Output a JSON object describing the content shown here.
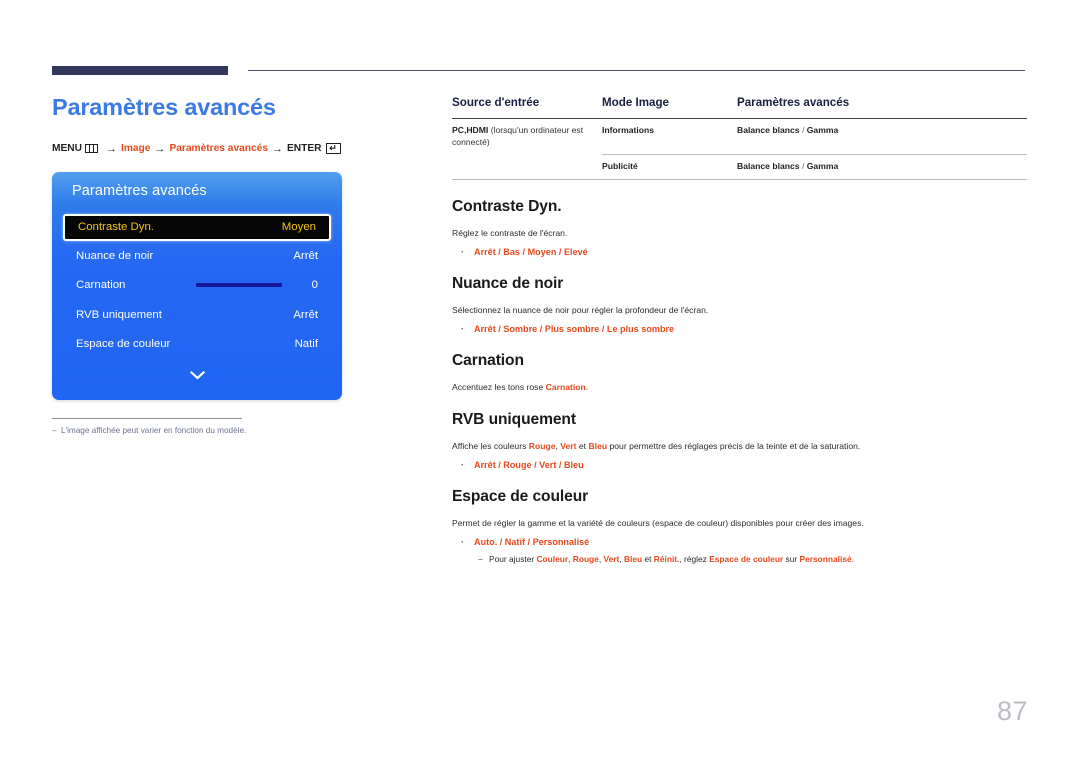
{
  "document": {
    "page_number": "87",
    "page_title": "Paramètres avancés"
  },
  "menu_path": {
    "menu_label": "MENU",
    "menu_icon": "menu-bars-icon",
    "arrow": "→",
    "step1": "Image",
    "step2": "Paramètres avancés",
    "enter_label": "ENTER",
    "enter_icon": "enter-key-icon",
    "enter_glyph": "↵"
  },
  "osd": {
    "title": "Paramètres avancés",
    "rows": [
      {
        "label": "Contraste Dyn.",
        "value": "Moyen",
        "selected": true,
        "slider": false
      },
      {
        "label": "Nuance de noir",
        "value": "Arrêt",
        "selected": false,
        "slider": false
      },
      {
        "label": "Carnation",
        "value": "0",
        "selected": false,
        "slider": true
      },
      {
        "label": "RVB uniquement",
        "value": "Arrêt",
        "selected": false,
        "slider": false
      },
      {
        "label": "Espace de couleur",
        "value": "Natif",
        "selected": false,
        "slider": false
      }
    ],
    "scroll_icon": "chevron-down-icon",
    "note_dash": "‒",
    "note": "L'image affichée peut varier en fonction du modèle."
  },
  "table": {
    "headers": {
      "col1": "Source d'entrée",
      "col2": "Mode Image",
      "col3": "Paramètres avancés"
    },
    "rows": [
      {
        "source_bold": "PC,HDMI",
        "source_plain": "(lorsqu'un ordinateur est connecté)",
        "mode": "Informations",
        "adv_a": "Balance blancs",
        "adv_sep": "/",
        "adv_b": "Gamma"
      },
      {
        "source_bold": "",
        "source_plain": "",
        "mode": "Publicité",
        "adv_a": "Balance blancs",
        "adv_sep": "/",
        "adv_b": "Gamma"
      }
    ]
  },
  "sections": [
    {
      "heading": "Contraste Dyn.",
      "body_pre": "Réglez le contraste de l'écran.",
      "bullet_dot": "·",
      "options": [
        "Arrêt",
        "Bas",
        "Moyen",
        "Elevé"
      ],
      "options_joined": "Arrêt / Bas / Moyen / Elevé"
    },
    {
      "heading": "Nuance de noir",
      "body_pre": "Sélectionnez la nuance de noir pour régler la profondeur de l'écran.",
      "bullet_dot": "·",
      "options": [
        "Arrêt",
        "Sombre",
        "Plus sombre",
        "Le plus sombre"
      ],
      "options_joined": "Arrêt / Sombre / Plus sombre / Le plus sombre"
    },
    {
      "heading": "Carnation",
      "body_pre": "Accentuez les tons rose ",
      "body_red": "Carnation",
      "body_post": ".",
      "options": [],
      "options_joined": ""
    },
    {
      "heading": "RVB uniquement",
      "body_p1": "Affiche les couleurs ",
      "body_r1": "Rouge",
      "body_p2": ", ",
      "body_r2": "Vert",
      "body_p3": " et ",
      "body_r3": "Bleu",
      "body_p4": " pour permettre des réglages précis de la teinte et de la saturation.",
      "bullet_dot": "·",
      "options": [
        "Arrêt",
        "Rouge",
        "Vert",
        "Bleu"
      ],
      "options_joined": "Arrêt / Rouge / Vert / Bleu"
    },
    {
      "heading": "Espace de couleur",
      "body_pre": "Permet de régler la gamme et la variété de couleurs (espace de couleur) disponibles pour créer des images.",
      "bullet_dot": "·",
      "options": [
        "Auto.",
        "Natif",
        "Personnalisé"
      ],
      "options_joined": "Auto. / Natif / Personnalisé",
      "subnote": {
        "dash": "‒",
        "p1": "Pour ajuster ",
        "r1": "Couleur",
        "p2": ", ",
        "r2": "Rouge",
        "p3": ", ",
        "r3": "Vert",
        "p4": ", ",
        "r4": "Bleu",
        "p5": " et ",
        "r5": "Réinit.",
        "p6": ", réglez ",
        "r6": "Espace de couleur",
        "p7": " sur ",
        "r7": "Personnalisé",
        "p8": "."
      }
    }
  ],
  "colors": {
    "title_blue": "#3b7ae4",
    "accent_red": "#e8491d",
    "navy": "#32375c",
    "osd_blue": "#2064f3",
    "osd_highlight_text": "#f2c318",
    "page_num_gray": "#b9bcc4"
  }
}
